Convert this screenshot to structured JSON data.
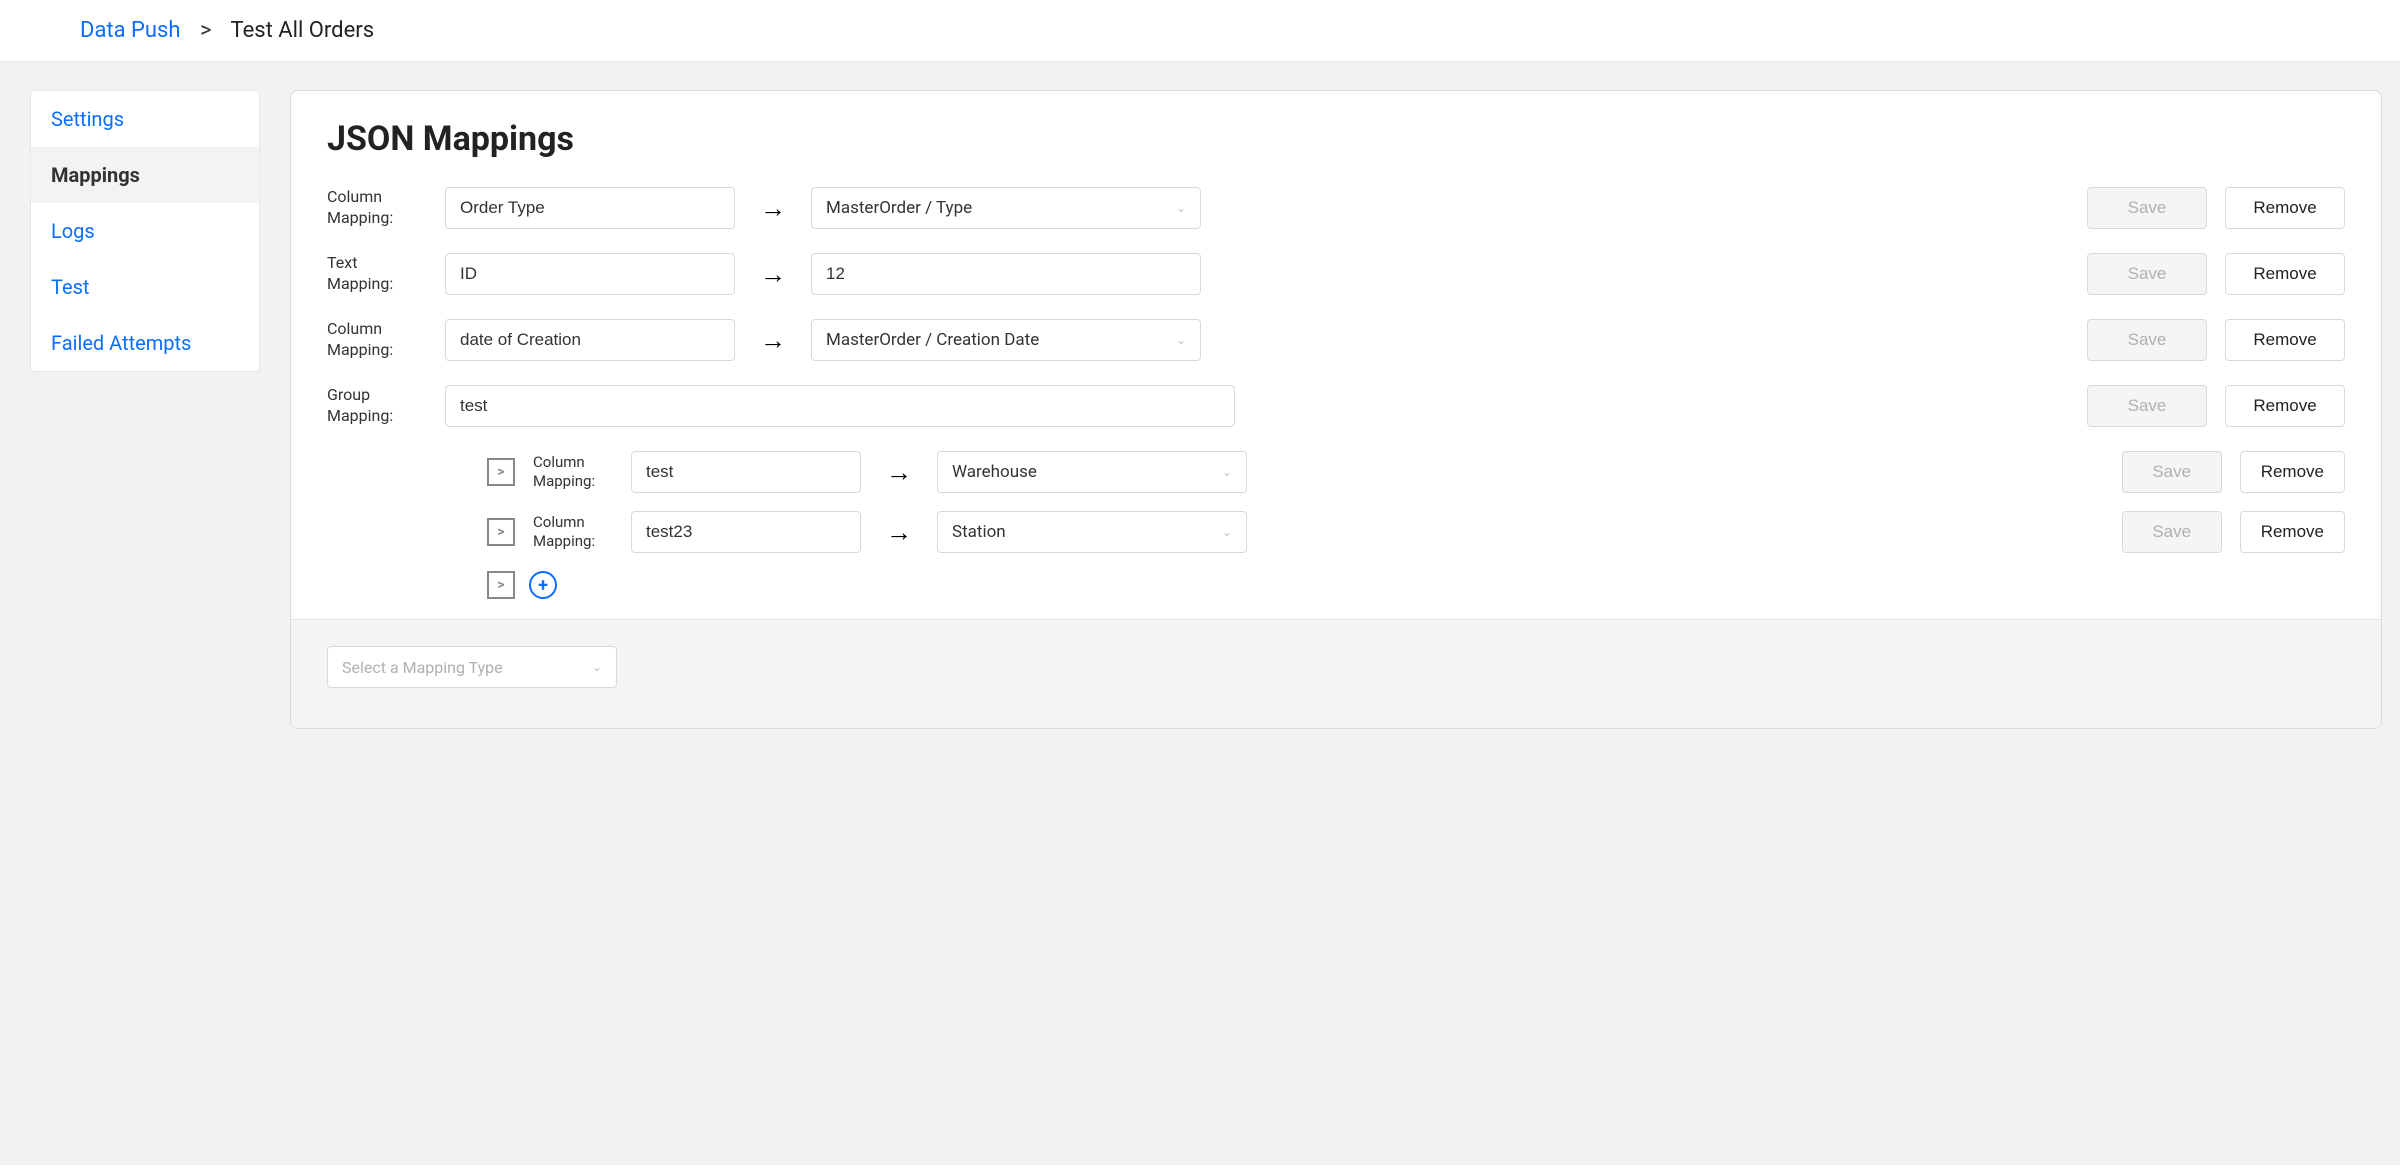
{
  "breadcrumb": {
    "parent": "Data Push",
    "separator": ">",
    "current": "Test All Orders"
  },
  "sidebar": {
    "items": [
      {
        "label": "Settings",
        "active": false
      },
      {
        "label": "Mappings",
        "active": true
      },
      {
        "label": "Logs",
        "active": false
      },
      {
        "label": "Test",
        "active": false
      },
      {
        "label": "Failed Attempts",
        "active": false
      }
    ]
  },
  "page": {
    "title": "JSON Mappings"
  },
  "labels": {
    "column_mapping": "Column Mapping:",
    "text_mapping": "Text Mapping:",
    "group_mapping": "Group Mapping:"
  },
  "buttons": {
    "save": "Save",
    "remove": "Remove"
  },
  "mappings": [
    {
      "type": "column",
      "source": "Order Type",
      "target": "MasterOrder / Type"
    },
    {
      "type": "text",
      "source": "ID",
      "target": "12"
    },
    {
      "type": "column",
      "source": "date of Creation",
      "target": "MasterOrder / Creation Date"
    },
    {
      "type": "group",
      "source": "test",
      "children": [
        {
          "type": "column",
          "source": "test",
          "target": "Warehouse"
        },
        {
          "type": "column",
          "source": "test23",
          "target": "Station"
        }
      ]
    }
  ],
  "footer": {
    "placeholder": "Select a Mapping Type"
  }
}
